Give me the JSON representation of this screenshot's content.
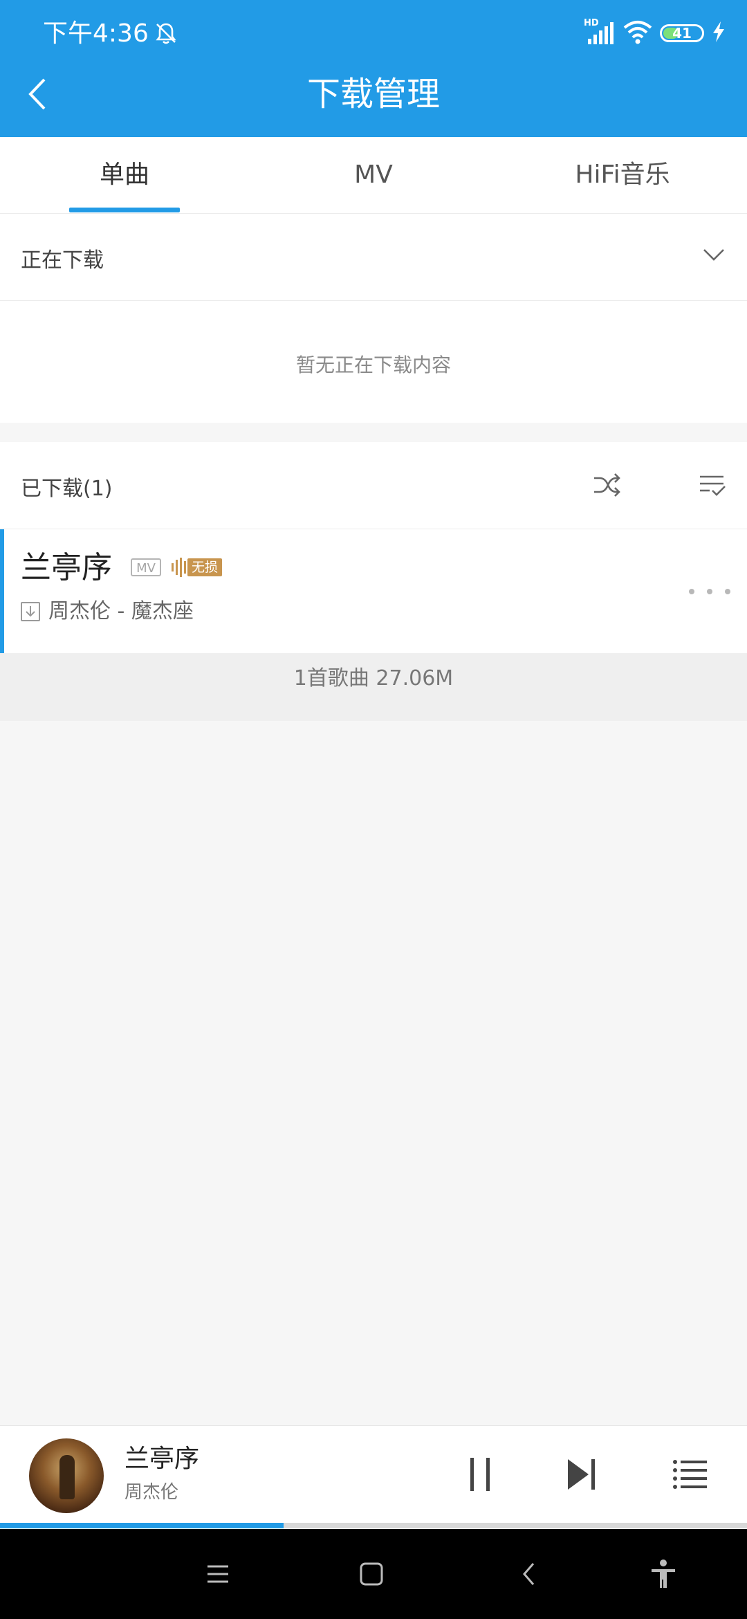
{
  "status_bar": {
    "time": "下午4:36",
    "network": "HD",
    "battery": "41",
    "battery_level": 0.41
  },
  "header": {
    "title": "下载管理"
  },
  "tabs": [
    {
      "label": "单曲",
      "active": true
    },
    {
      "label": "MV",
      "active": false
    },
    {
      "label": "HiFi音乐",
      "active": false
    }
  ],
  "downloading": {
    "label": "正在下载",
    "empty_message": "暂无正在下载内容"
  },
  "downloaded": {
    "label": "已下载(1)",
    "songs": [
      {
        "title": "兰亭序",
        "mv_badge": "MV",
        "quality_badge": "无损",
        "subtitle": "周杰伦 - 魔杰座"
      }
    ],
    "summary": "1首歌曲 27.06M"
  },
  "player": {
    "title": "兰亭序",
    "artist": "周杰伦",
    "progress": 0.38
  },
  "colors": {
    "accent": "#229be6",
    "lossless": "#c8954e"
  },
  "icons": [
    "back-arrow-icon",
    "dnd-bell-icon",
    "signal-icon",
    "wifi-icon",
    "battery-icon",
    "charging-icon",
    "chevron-down-icon",
    "shuffle-icon",
    "sort-check-icon",
    "download-icon",
    "more-icon",
    "pause-icon",
    "next-icon",
    "playlist-icon",
    "menu-icon",
    "home-icon",
    "back-icon",
    "accessibility-icon"
  ]
}
